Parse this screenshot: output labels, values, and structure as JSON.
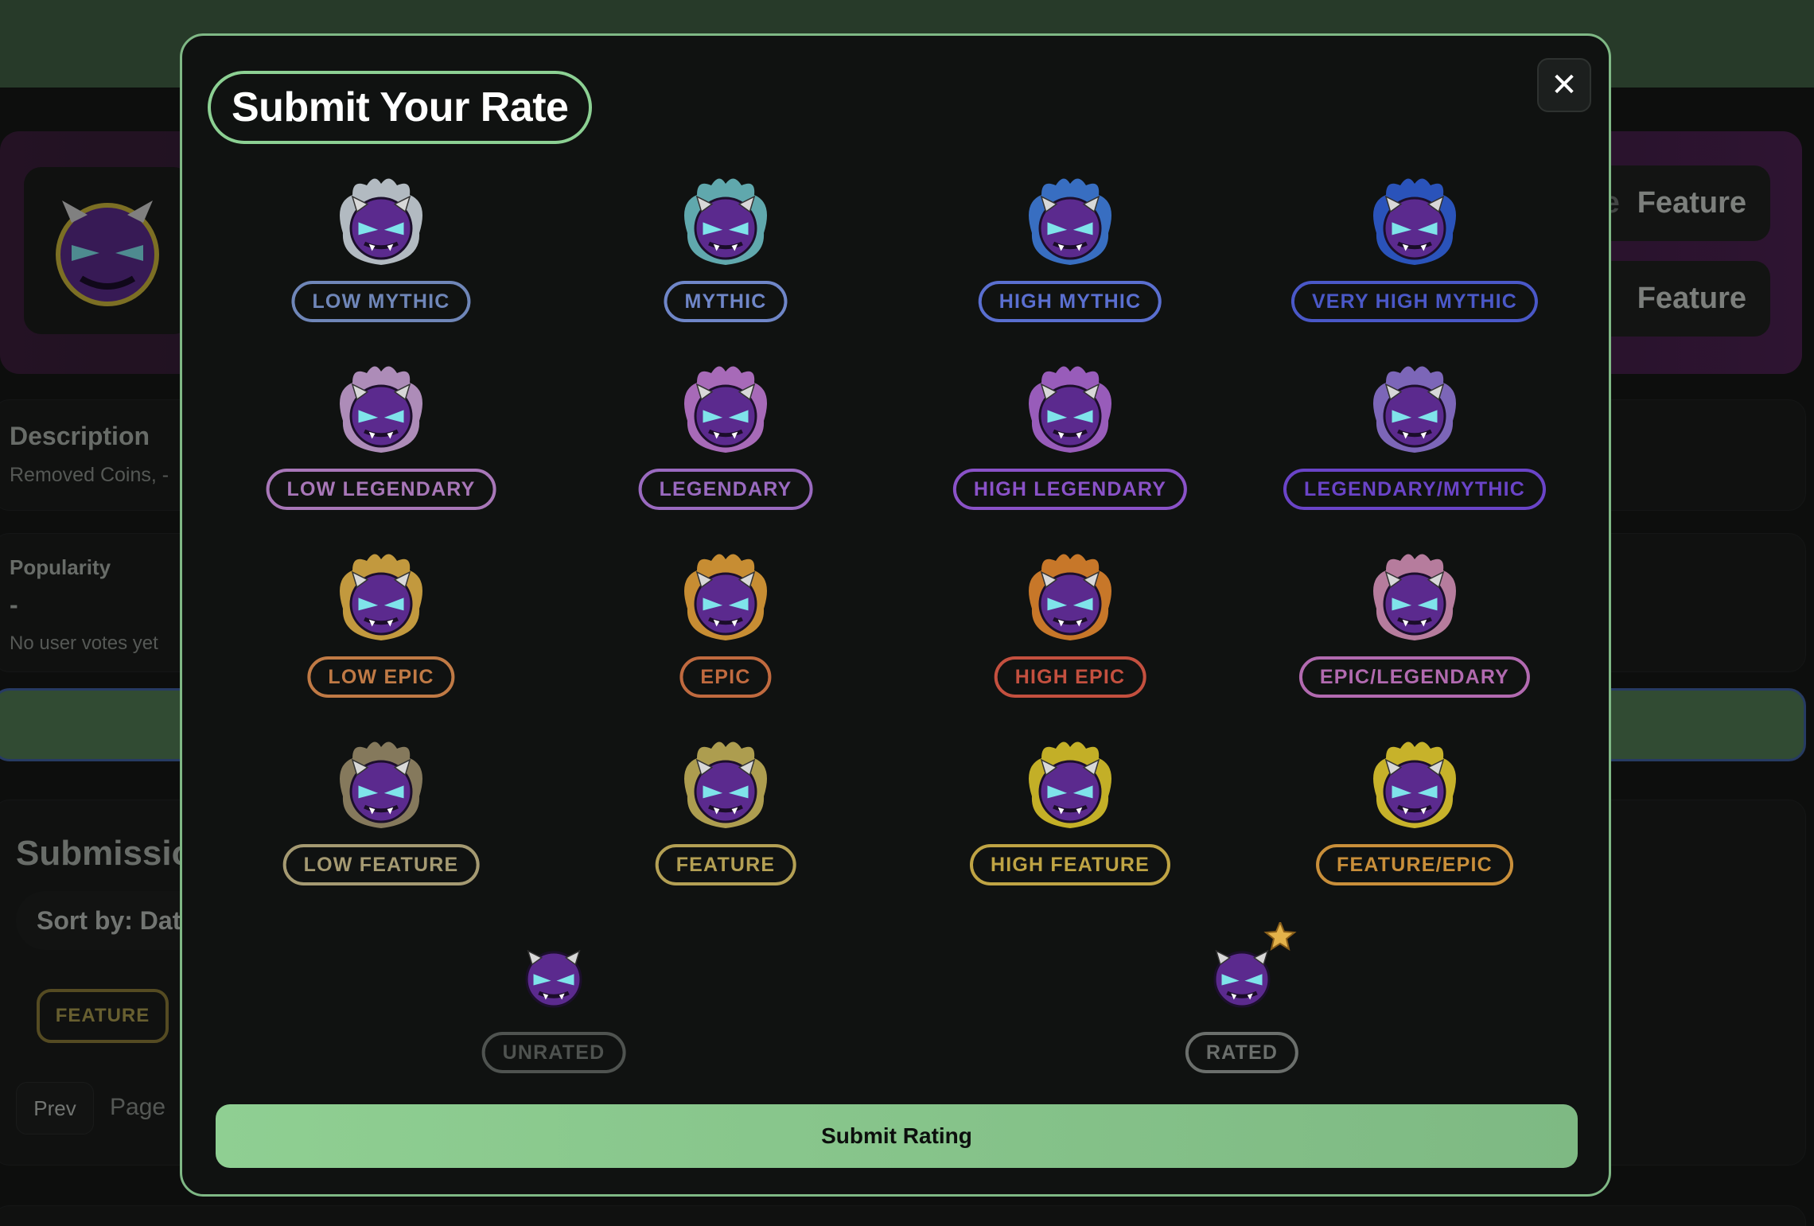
{
  "modal": {
    "title": "Submit Your Rate",
    "close_icon": "close-icon",
    "submit_label": "Submit Rating"
  },
  "options": [
    {
      "label": "LOW MYTHIC",
      "color": "#6f86b8",
      "aura": "#cfd8e0"
    },
    {
      "label": "MYTHIC",
      "color": "#6f86c8",
      "aura": "#6fc3c9"
    },
    {
      "label": "HIGH MYTHIC",
      "color": "#5a6fd0",
      "aura": "#3f7fe0"
    },
    {
      "label": "VERY HIGH MYTHIC",
      "color": "#4a58c8",
      "aura": "#2f5fd8"
    },
    {
      "label": "LOW LEGENDARY",
      "color": "#a877b8",
      "aura": "#c9a2d6"
    },
    {
      "label": "LEGENDARY",
      "color": "#9a6ac0",
      "aura": "#c27ad6"
    },
    {
      "label": "HIGH LEGENDARY",
      "color": "#8a52c8",
      "aura": "#b06ad8"
    },
    {
      "label": "LEGENDARY/MYTHIC",
      "color": "#6a44c8",
      "aura": "#8f76d6"
    },
    {
      "label": "LOW EPIC",
      "color": "#c07a45",
      "aura": "#e2b247"
    },
    {
      "label": "EPIC",
      "color": "#c06a3f",
      "aura": "#e7a33a"
    },
    {
      "label": "HIGH EPIC",
      "color": "#c4503f",
      "aura": "#e8892e"
    },
    {
      "label": "EPIC/LEGENDARY",
      "color": "#b26ab0",
      "aura": "#d48fb6"
    },
    {
      "label": "LOW FEATURE",
      "color": "#a59a72",
      "aura": "#9a8c6a"
    },
    {
      "label": "FEATURE",
      "color": "#b4a054",
      "aura": "#c9b65a"
    },
    {
      "label": "HIGH FEATURE",
      "color": "#bfa444",
      "aura": "#e3cb2c"
    },
    {
      "label": "FEATURE/EPIC",
      "color": "#c98f3a",
      "aura": "#e7cf2f"
    },
    {
      "label": "UNRATED",
      "color": "#4f5350",
      "aura": ""
    },
    {
      "label": "RATED",
      "color": "#6b6f6c",
      "aura": "",
      "star_icon": "star-icon"
    }
  ],
  "background": {
    "feature_pill_1": "Feature",
    "feature_pill_2": "Feature",
    "feature_pill_1_prefix": "e",
    "description_title": "Description",
    "description_text": "Removed Coins, -",
    "popularity_title": "Popularity",
    "popularity_value": "-",
    "popularity_note": "No user votes yet",
    "submissions_title": "Submissio",
    "sort_label": "Sort by: Dat",
    "feature_badge": "FEATURE",
    "prev_label": "Prev",
    "page_label": "Page"
  }
}
